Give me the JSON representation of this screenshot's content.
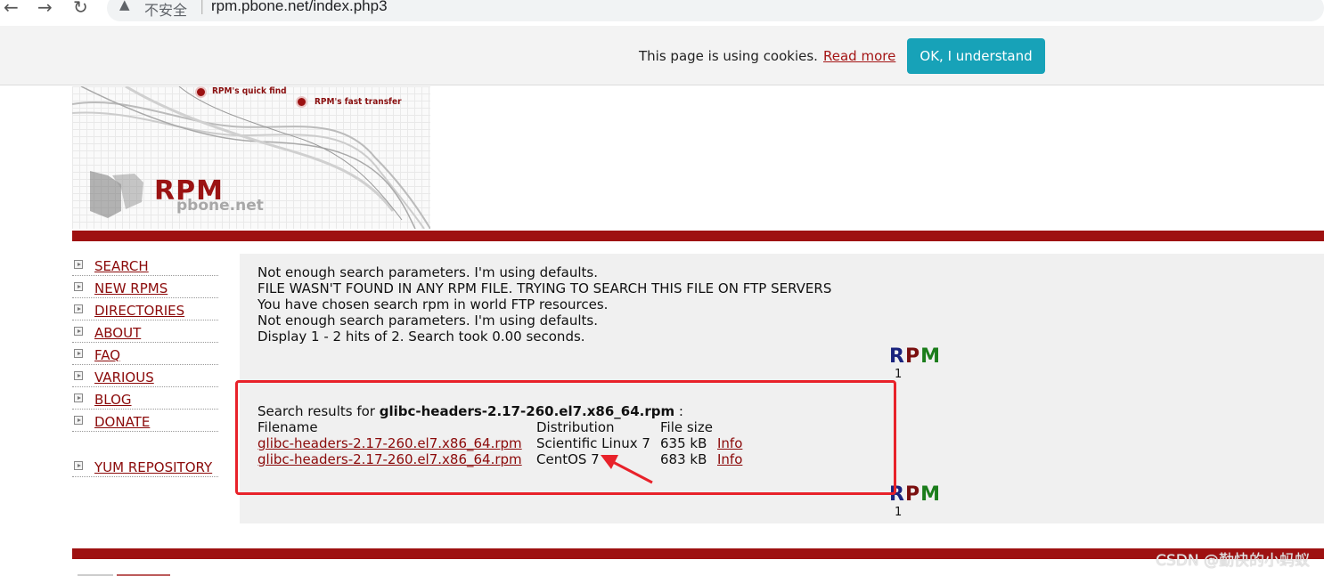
{
  "browser": {
    "security_label": "不安全",
    "url": "rpm.pbone.net/index.php3",
    "back_icon": "arrow-left-icon",
    "forward_icon": "arrow-right-icon",
    "reload_icon": "reload-icon",
    "warning_icon": "warning-triangle-icon"
  },
  "cookie_bar": {
    "message": "This page is using cookies.",
    "read_more": "Read more",
    "ok_button": "OK, I understand",
    "button_color": "#17a2b8"
  },
  "banner": {
    "bullet1": "RPM's quick find",
    "bullet2": "RPM's fast transfer",
    "logo": "RPM",
    "logo_sub": "pbone.net",
    "rule_color": "#9e1111"
  },
  "sidebar": {
    "items": [
      {
        "label": "SEARCH"
      },
      {
        "label": "NEW RPMS"
      },
      {
        "label": "DIRECTORIES"
      },
      {
        "label": "ABOUT"
      },
      {
        "label": "FAQ"
      },
      {
        "label": "VARIOUS"
      },
      {
        "label": "BLOG"
      },
      {
        "label": "DONATE"
      },
      {
        "label": "YUM REPOSITORY"
      }
    ]
  },
  "messages": [
    "Not enough search parameters. I'm using defaults.",
    "FILE WASN'T FOUND IN ANY RPM FILE. TRYING TO SEARCH THIS FILE ON FTP SERVERS",
    "You have chosen search rpm in world FTP resources.",
    "Not enough search parameters. I'm using defaults.",
    "Display 1 - 2 hits of 2. Search took 0.00 seconds."
  ],
  "rpm_badge": {
    "letters": [
      "R",
      "P",
      "M"
    ],
    "number": "1"
  },
  "results": {
    "prefix": "Search results for ",
    "query": "glibc-headers-2.17-260.el7.x86_64.rpm",
    "suffix": " :",
    "headers": {
      "filename": "Filename",
      "distribution": "Distribution",
      "filesize": "File size"
    },
    "rows": [
      {
        "filename": "glibc-headers-2.17-260.el7.x86_64.rpm",
        "distribution": "Scientific Linux 7",
        "size": "635 kB",
        "info": "Info"
      },
      {
        "filename": "glibc-headers-2.17-260.el7.x86_64.rpm",
        "distribution": "CentOS 7",
        "size": "683 kB",
        "info": "Info"
      }
    ]
  },
  "annotation": {
    "box_color": "#e8222a"
  },
  "watermark": "CSDN @勤快的小蚂蚁"
}
